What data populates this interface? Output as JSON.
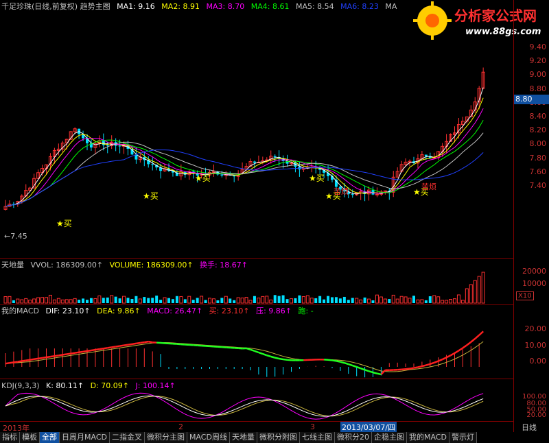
{
  "main": {
    "title": "千足珍珠(日线,前复权) 趋势主图",
    "ma": [
      {
        "label": "MA1: 9.16",
        "color": "#ffffff"
      },
      {
        "label": "MA2: 8.91",
        "color": "#ffff00"
      },
      {
        "label": "MA3: 8.70",
        "color": "#ff00ff"
      },
      {
        "label": "MA4: 8.61",
        "color": "#00ff00"
      },
      {
        "label": "MA5: 8.54",
        "color": "#c0c0c0"
      },
      {
        "label": "MA6: 8.23",
        "color": "#0000ff"
      },
      {
        "label": "MA",
        "color": "#c0c0c0"
      }
    ],
    "y_labels": [
      "9.40",
      "9.20",
      "9.00",
      "8.80",
      "8.60",
      "8.40",
      "8.20",
      "8.00",
      "7.80",
      "7.60",
      "7.40"
    ],
    "current_price": "8.80",
    "low_annot": "←7.45",
    "buy_label": "★买",
    "top_label": "苦烦",
    "buy_text": "买"
  },
  "volume": {
    "title": "天地量",
    "vol": "VVOL: 186309.00↑",
    "volume": "VOLUME: 186309.00↑",
    "turnover": "换手: 18.67↑",
    "y_labels": [
      "20000",
      "10000"
    ],
    "scale": "X10"
  },
  "macd": {
    "title": "我的MACD",
    "dif": "DIF: 23.10↑",
    "dea": "DEA: 9.86↑",
    "macd": "MACD: 26.47↑",
    "buy": "买: 23.10↑",
    "press": "压: 9.86↑",
    "run": "跑: -",
    "y_labels": [
      "20.00",
      "10.00",
      "0.00"
    ]
  },
  "kdj": {
    "title": "KDJ(9,3,3)",
    "k": "K: 80.11↑",
    "d": "D: 70.09↑",
    "j": "J: 100.14↑",
    "y_labels": [
      "100.00",
      "80.00",
      "50.00",
      "20.00"
    ]
  },
  "timeline": {
    "year": "2013年",
    "m2": "2",
    "m3": "3",
    "cursor_date": "2013/03/07/四",
    "period": "日线"
  },
  "tabs": [
    "指标",
    "模板",
    "全部",
    "日周月MACD",
    "二指金叉",
    "微积分主图",
    "MACD周线",
    "天地量",
    "微积分附图",
    "七线主图",
    "微积分20",
    "企稳主图",
    "我的MACD",
    "警示灯"
  ],
  "logo": {
    "text": "分析家公式网",
    "url": "www.88gs.com"
  }
}
